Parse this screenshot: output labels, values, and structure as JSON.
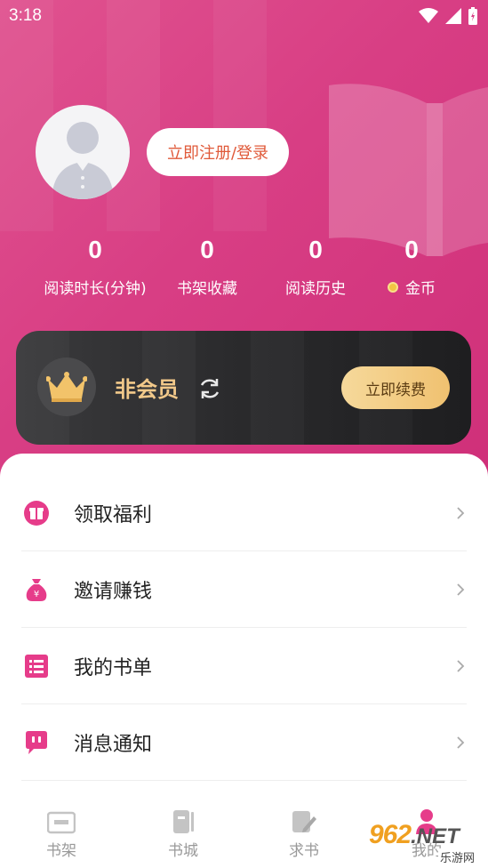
{
  "status_bar": {
    "time": "3:18"
  },
  "profile": {
    "login_label": "立即注册/登录"
  },
  "stats": [
    {
      "value": "0",
      "label": "阅读时长(分钟)"
    },
    {
      "value": "0",
      "label": "书架收藏"
    },
    {
      "value": "0",
      "label": "阅读历史"
    },
    {
      "value": "0",
      "label": "金币"
    }
  ],
  "vip": {
    "status_label": "非会员",
    "renew_label": "立即续费"
  },
  "menu": [
    {
      "label": "领取福利",
      "icon": "gift-icon"
    },
    {
      "label": "邀请赚钱",
      "icon": "money-bag-icon"
    },
    {
      "label": "我的书单",
      "icon": "list-icon"
    },
    {
      "label": "消息通知",
      "icon": "message-icon"
    }
  ],
  "tabs": [
    {
      "label": "书架",
      "icon": "bookshelf-icon"
    },
    {
      "label": "书城",
      "icon": "bookstore-icon"
    },
    {
      "label": "求书",
      "icon": "request-book-icon"
    },
    {
      "label": "我的",
      "icon": "profile-icon"
    }
  ],
  "watermark": {
    "main": "962",
    "suffix": ".NET",
    "sub": "乐游网"
  },
  "colors": {
    "accent": "#e63c8a",
    "hero": "#d83e84",
    "gold": "#f2c98a"
  }
}
